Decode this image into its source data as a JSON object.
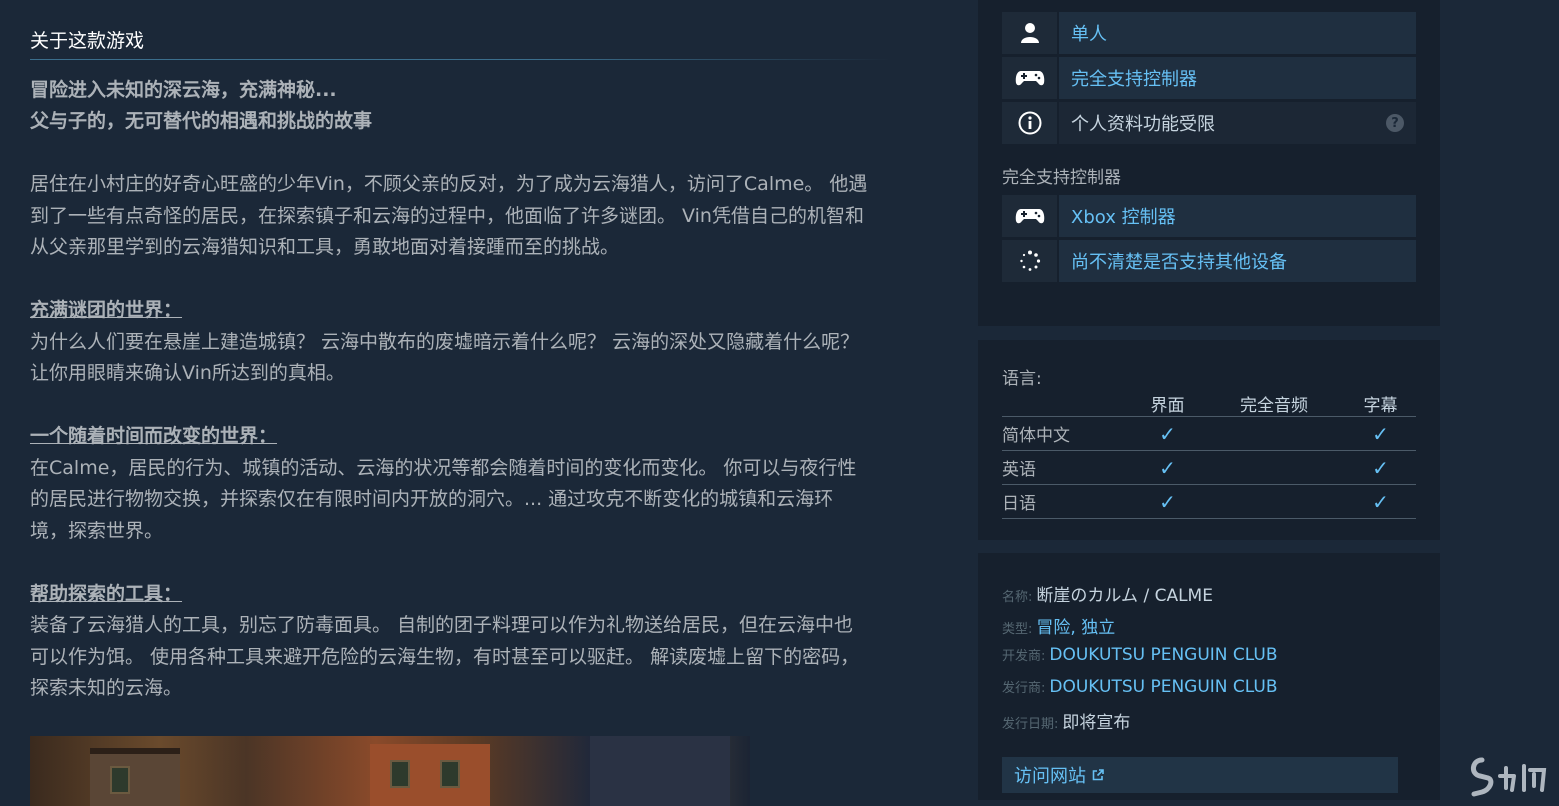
{
  "about": {
    "title": "关于这款游戏",
    "tagline1": "冒险进入未知的深云海，充满神秘...",
    "tagline2": "父与子的，无可替代的相遇和挑战的故事",
    "intro1": "居住在小村庄的好奇心旺盛的少年Vin，不顾父亲的反对，为了成为云海猎人，访问了Calme。 他遇",
    "intro2": "到了一些有点奇怪的居民，在探索镇子和云海的过程中，他面临了许多谜团。 Vin凭借自己的机智和",
    "intro3": "从父亲那里学到的云海猎知识和工具，勇敢地面对着接踵而至的挑战。",
    "sec1_heading": "充满谜团的世界：",
    "sec1_line1": "为什么人们要在悬崖上建造城镇？ 云海中散布的废墟暗示着什么呢？ 云海的深处又隐藏着什么呢？",
    "sec1_line2": "让你用眼睛来确认Vin所达到的真相。",
    "sec2_heading": "一个随着时间而改变的世界：",
    "sec2_line1": "在Calme，居民的行为、城镇的活动、云海的状况等都会随着时间的变化而变化。 你可以与夜行性",
    "sec2_line2": "的居民进行物物交换，并探索仅在有限时间内开放的洞穴。... 通过攻克不断变化的城镇和云海环",
    "sec2_line3": "境，探索世界。",
    "sec3_heading": "帮助探索的工具：",
    "sec3_line1": "装备了云海猎人的工具，别忘了防毒面具。 自制的团子料理可以作为礼物送给居民，但在云海中也",
    "sec3_line2": "可以作为饵。 使用各种工具来避开危险的云海生物，有时甚至可以驱赶。 解读废墟上留下的密码，",
    "sec3_line3": "探索未知的云海。"
  },
  "features": {
    "items": [
      {
        "label": "单人",
        "icon": "single-player-icon"
      },
      {
        "label": "完全支持控制器",
        "icon": "controller-icon"
      },
      {
        "label": "个人资料功能受限",
        "icon": "info-icon"
      }
    ],
    "help_glyph": "?",
    "controller_heading": "完全支持控制器",
    "controller_items": [
      {
        "label": "Xbox 控制器",
        "icon": "controller-icon"
      },
      {
        "label": "尚不清楚是否支持其他设备",
        "icon": "loading-icon"
      }
    ]
  },
  "languages": {
    "title": "语言:",
    "columns": [
      "界面",
      "完全音频",
      "字幕"
    ],
    "check": "✓",
    "rows": [
      {
        "name": "简体中文"
      },
      {
        "name": "英语"
      },
      {
        "name": "日语"
      }
    ]
  },
  "details": {
    "name_label": "名称:",
    "name_value": "断崖のカルム / CALME",
    "genre_label": "类型:",
    "genre1": "冒险",
    "genre_sep": ",",
    "genre2": "独立",
    "developer_label": "开发商:",
    "developer": "DOUKUTSU PENGUIN CLUB",
    "publisher_label": "发行商:",
    "publisher": "DOUKUTSU PENGUIN CLUB",
    "release_label": "发行日期:",
    "release": "即将宣布",
    "visit_label": "访问网站"
  },
  "colors": {
    "accent": "#66c0f4",
    "bg": "#1b2838",
    "panel": "#16202d"
  }
}
